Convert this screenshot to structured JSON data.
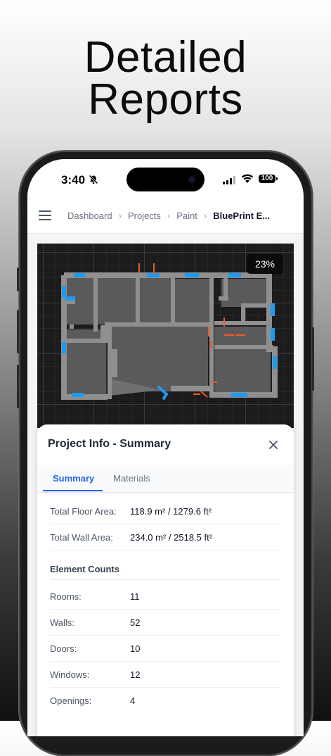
{
  "headline": {
    "line1": "Detailed",
    "line2": "Reports"
  },
  "status_bar": {
    "time": "3:40",
    "battery": "100",
    "icons": [
      "bell-slash-icon",
      "signal-icon",
      "wifi-icon",
      "battery-icon"
    ]
  },
  "nav": {
    "menu_icon": "hamburger-menu-icon",
    "breadcrumbs": [
      "Dashboard",
      "Projects",
      "Paint",
      "BluePrint E..."
    ],
    "separator": "›"
  },
  "canvas": {
    "zoom": "23%"
  },
  "sheet": {
    "title": "Project Info - Summary",
    "close_icon": "close-icon",
    "tabs": [
      {
        "label": "Summary",
        "active": true
      },
      {
        "label": "Materials",
        "active": false
      }
    ],
    "areas": [
      {
        "label": "Total Floor Area:",
        "value": "118.9 m² / 1279.6 ft²"
      },
      {
        "label": "Total Wall Area:",
        "value": "234.0 m² / 2518.5 ft²"
      }
    ],
    "counts_title": "Element Counts",
    "counts": [
      {
        "label": "Rooms:",
        "value": "11"
      },
      {
        "label": "Walls:",
        "value": "52"
      },
      {
        "label": "Doors:",
        "value": "10"
      },
      {
        "label": "Windows:",
        "value": "12"
      },
      {
        "label": "Openings:",
        "value": "4"
      }
    ]
  },
  "colors": {
    "accent": "#2563eb",
    "wall": "#8f8f8f",
    "window": "#1e9bf0",
    "door": "#f05a28",
    "canvas_bg": "#1c1c1c"
  }
}
